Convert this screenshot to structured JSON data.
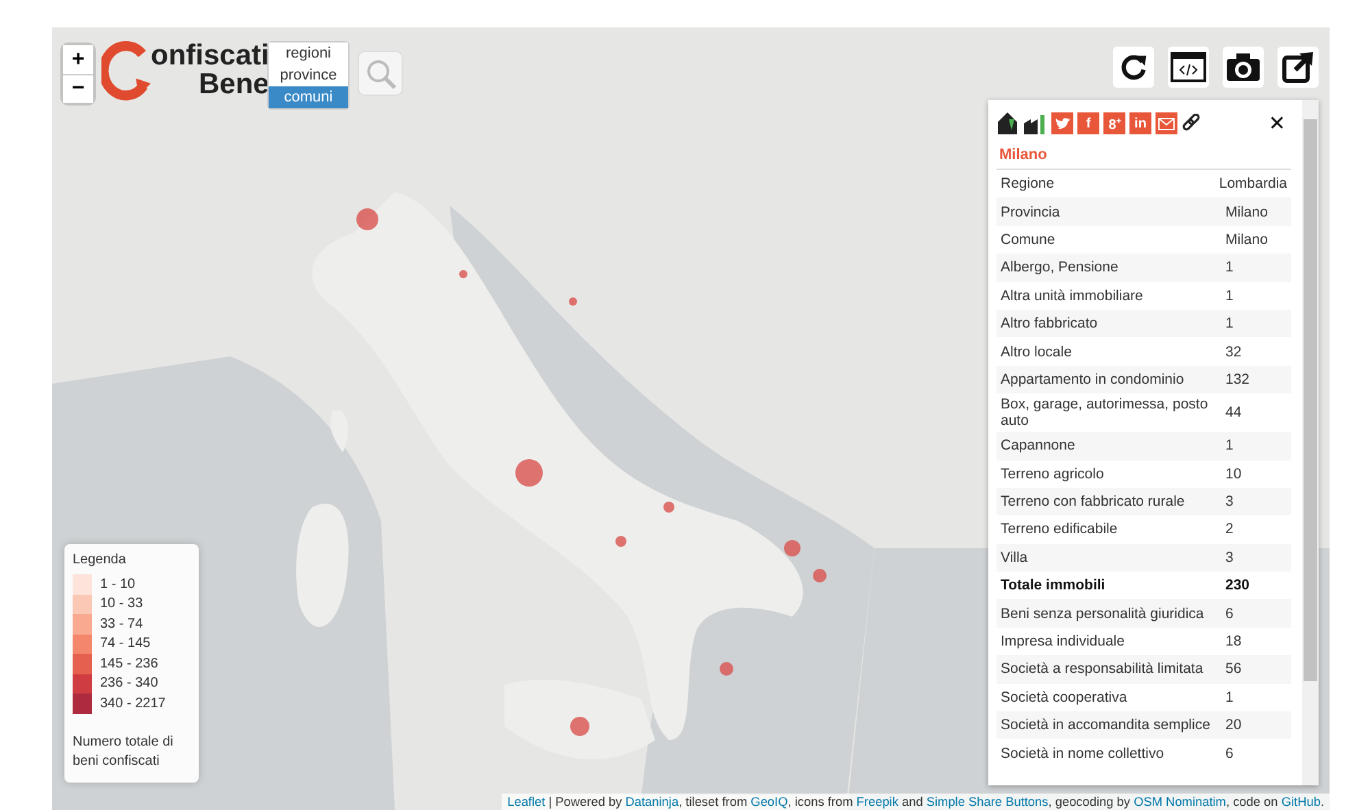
{
  "zoom": {
    "in": "+",
    "out": "−"
  },
  "logo": {
    "line1": "onfiscati",
    "line2": "Bene"
  },
  "levels": [
    {
      "label": "regioni",
      "selected": false
    },
    {
      "label": "province",
      "selected": false
    },
    {
      "label": "comuni",
      "selected": true
    }
  ],
  "panel": {
    "close": "✕",
    "title": "Milano",
    "share": [
      {
        "kind": "twitter"
      },
      {
        "kind": "facebook",
        "label": "f"
      },
      {
        "kind": "googleplus",
        "label": "8⁺"
      },
      {
        "kind": "linkedin",
        "label": "in"
      },
      {
        "kind": "email"
      }
    ],
    "rows": [
      {
        "label": "Regione",
        "value": "Lombardia",
        "kind": "info"
      },
      {
        "label": "Provincia",
        "value": "Milano",
        "kind": "info"
      },
      {
        "label": "Comune",
        "value": "Milano",
        "kind": "info"
      },
      {
        "label": "Albergo, Pensione",
        "value": "1",
        "kind": "item"
      },
      {
        "label": "Altra unità immobiliare",
        "value": "1",
        "kind": "item"
      },
      {
        "label": "Altro fabbricato",
        "value": "1",
        "kind": "item"
      },
      {
        "label": "Altro locale",
        "value": "32",
        "kind": "item"
      },
      {
        "label": "Appartamento in condominio",
        "value": "132",
        "kind": "item"
      },
      {
        "label": "Box, garage, autorimessa, posto auto",
        "value": "44",
        "kind": "item"
      },
      {
        "label": "Capannone",
        "value": "1",
        "kind": "item"
      },
      {
        "label": "Terreno agricolo",
        "value": "10",
        "kind": "item"
      },
      {
        "label": "Terreno con fabbricato rurale",
        "value": "3",
        "kind": "item"
      },
      {
        "label": "Terreno edificabile",
        "value": "2",
        "kind": "item"
      },
      {
        "label": "Villa",
        "value": "3",
        "kind": "item"
      },
      {
        "label": "Totale immobili",
        "value": "230",
        "kind": "total"
      },
      {
        "label": "Beni senza personalità giuridica",
        "value": "6",
        "kind": "item"
      },
      {
        "label": "Impresa individuale",
        "value": "18",
        "kind": "item"
      },
      {
        "label": "Società a responsabilità limitata",
        "value": "56",
        "kind": "item"
      },
      {
        "label": "Società cooperativa",
        "value": "1",
        "kind": "item"
      },
      {
        "label": "Società in accomandita semplice",
        "value": "20",
        "kind": "item"
      },
      {
        "label": "Società in nome collettivo",
        "value": "6",
        "kind": "item"
      }
    ]
  },
  "legend": {
    "title": "Legenda",
    "bins": [
      {
        "label": "1 - 10",
        "color": "#fde3da"
      },
      {
        "label": "10 - 33",
        "color": "#fbc8b5"
      },
      {
        "label": "33 - 74",
        "color": "#f9a98f"
      },
      {
        "label": "74 - 145",
        "color": "#f3866b"
      },
      {
        "label": "145 - 236",
        "color": "#e5604e"
      },
      {
        "label": "236 - 340",
        "color": "#cf3d43"
      },
      {
        "label": "340 - 2217",
        "color": "#ad2a3f"
      }
    ],
    "note": "Numero totale di beni confiscati"
  },
  "attribution": [
    {
      "text": "Leaflet",
      "link": true
    },
    {
      "text": " | Powered by ",
      "link": false
    },
    {
      "text": "Dataninja",
      "link": true
    },
    {
      "text": ", tileset from ",
      "link": false
    },
    {
      "text": "GeoIQ",
      "link": true
    },
    {
      "text": ", icons from ",
      "link": false
    },
    {
      "text": "Freepik",
      "link": true
    },
    {
      "text": " and ",
      "link": false
    },
    {
      "text": "Simple Share Buttons",
      "link": true
    },
    {
      "text": ", geocoding by ",
      "link": false
    },
    {
      "text": "OSM Nominatim",
      "link": true
    },
    {
      "text": ", code on ",
      "link": false
    },
    {
      "text": "GitHub",
      "link": true
    },
    {
      "text": ".",
      "link": false
    }
  ]
}
